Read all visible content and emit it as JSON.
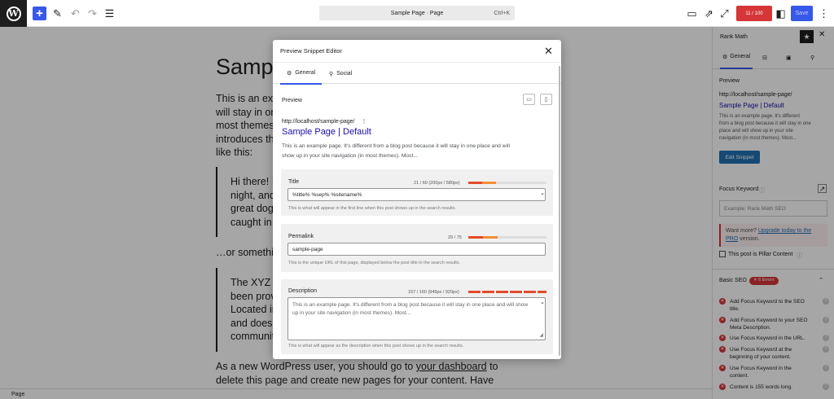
{
  "topbar": {
    "logo_glyph": "W",
    "add_glyph": "+",
    "command": {
      "title": "Sample Page · Page",
      "shortcut": "Ctrl+K"
    },
    "rank_math_score": "11 / 100",
    "save_label": "Save"
  },
  "canvas": {
    "page_title": "Sample Page",
    "lines": [
      "This is an example page. It's different from a blog post because it",
      "will stay in one place and will show up in your site navigation (in",
      "most themes). Most people start with an About page that",
      "introduces them to potential site visitors. It might say something",
      "like this:"
    ],
    "quote1": [
      "Hi there! I'm a bike messenger by day, aspiring actor by",
      "night, and this is my website. I live in Los Angeles, have a",
      "great dog named Jack, and I like piña coladas. (And gettin'",
      "caught in the rain.)"
    ],
    "or_something": "…or something like this:",
    "quote2": [
      "The XYZ Doohickey Company was founded in 1971, and has",
      "been providing quality doohickeys to the public ever since.",
      "Located in Gotham City, XYZ employs over 2,000 people",
      "and does all kinds of awesome things for the Gotham",
      "community."
    ],
    "final_prefix": "As a new WordPress user, you should go to ",
    "final_link": "your dashboard",
    "final_suffix": " to",
    "final_line2": "delete this page and create new pages for your content. Have"
  },
  "statusbar": {
    "text": "Page"
  },
  "sidebar": {
    "title": "Rank Math",
    "tab_general": "General",
    "preview_label": "Preview",
    "url": "http://localhost/sample-page/",
    "snippet_title": "Sample Page | Default",
    "snippet_desc": [
      "This is an example page. It's different",
      "from a blog post because it will stay in one",
      "place and will show up in your site",
      "navigation (in most themes). Most..."
    ],
    "edit_snippet": "Edit Snippet",
    "focus_keyword": "Focus Keyword",
    "fk_placeholder": "Example: Rank Math SEO",
    "upsell_prefix": "Want more? ",
    "upsell_link_1": "Upgrade today to the",
    "upsell_link_2": "PRO",
    "upsell_suffix": " version.",
    "pillar": "This post is Pillar Content",
    "basic_seo": "Basic SEO",
    "errors_badge": "✕ 6 Errors",
    "checks": [
      [
        "Add Focus Keyword to the SEO",
        "title."
      ],
      [
        "Add Focus Keyword to your SEO",
        "Meta Description."
      ],
      [
        "Use Focus Keyword in the URL."
      ],
      [
        "Use Focus Keyword at the",
        "beginning of your content."
      ],
      [
        "Use Focus Keyword in the",
        "content."
      ],
      [
        "Content is 155 words long."
      ]
    ]
  },
  "modal": {
    "title": "Preview Snippet Editor",
    "tab_general": "General",
    "tab_social": "Social",
    "preview_label": "Preview",
    "url": "http://localhost/sample-page/",
    "snippet_title": "Sample Page | Default",
    "snippet_desc_1": "This is an example page. It's different from a blog post because it will stay in one place and will",
    "snippet_desc_2": "show up in your site navigation (in most themes). Most...",
    "title_field": {
      "label": "Title",
      "count": "21 / 60 (200px / 580px)",
      "value": "%title% %sep% %sitename%",
      "help": "This is what will appear in the first line when this post shows up in the search results.",
      "fill": 0.35
    },
    "permalink_field": {
      "label": "Permalink",
      "count": "29 / 75",
      "value": "sample-page",
      "help": "This is the unique URL of this page, displayed below the post title in the search results.",
      "fill": 0.38
    },
    "description_field": {
      "label": "Description",
      "count": "157 / 160 (949px / 920px)",
      "value": "This is an example page. It's different from a blog post because it will stay in one place and will show up in your site navigation (in most themes). Most...",
      "help": "This is what will appear as the description when this post shows up in the search results.",
      "fill": 1.0
    }
  },
  "colors": {
    "accent": "#3858e9",
    "error": "#d63638",
    "bar_red": "#e34b2a",
    "bar_orange": "#f48e33",
    "link": "#1a0dab"
  }
}
